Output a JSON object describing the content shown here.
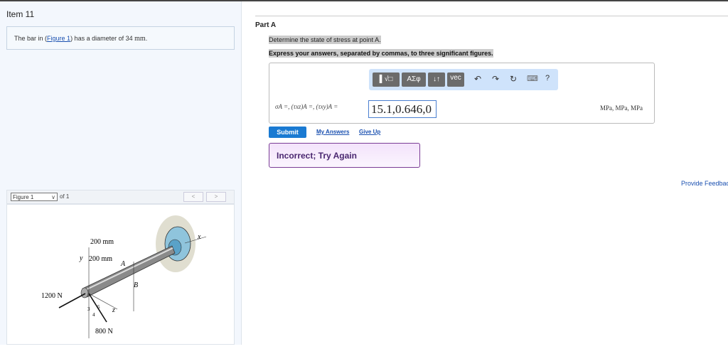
{
  "item": {
    "title": "Item 11"
  },
  "problem": {
    "prefix": "The bar in (",
    "link": "Figure 1",
    "suffix": ") has a diameter of 34 ",
    "unit": "mm",
    "end": "."
  },
  "figure": {
    "selector": "Figure 1",
    "of": "of 1",
    "prev": "<",
    "next": ">",
    "labels": {
      "dim1": "200 mm",
      "dim2": "200 mm",
      "y": "y",
      "x": "x",
      "z": "z",
      "A": "A",
      "B": "B",
      "f1": "1200 N",
      "f2": "800 N",
      "r3": "3",
      "r4": "4",
      "r5": "5"
    }
  },
  "partA": {
    "title": "Part A",
    "question": "Determine the state of stress at point A.",
    "instruction": "Express your answers, separated by commas, to three significant figures.",
    "toolbar": {
      "templates": "▌√□",
      "greek": "AΣφ",
      "arrows": "↓↑",
      "vec": "vec",
      "undo": "↶",
      "redo": "↷",
      "reset": "↻",
      "keyboard": "⌨",
      "help": "?"
    },
    "equation": "σA =, (τxz)A =, (τxy)A =",
    "answer": "15.1,0.646,0",
    "units": "MPa, MPa, MPa",
    "submit": "Submit",
    "my_answers": "My Answers",
    "give_up": "Give Up",
    "feedback": "Incorrect; Try Again"
  },
  "provide_feedback": "Provide Feedback"
}
